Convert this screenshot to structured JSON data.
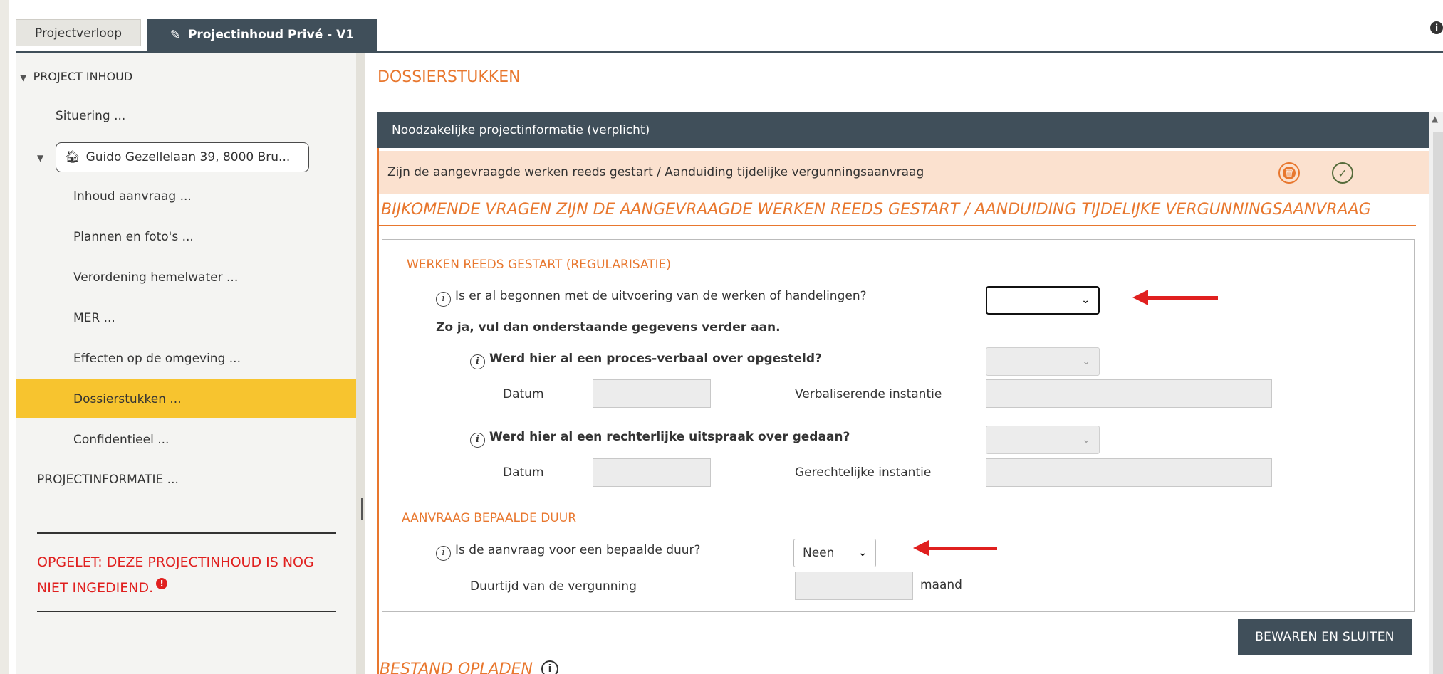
{
  "tabs": {
    "inactive_label": "Projectverloop",
    "active_label": "Projectinhoud Privé - V1"
  },
  "sidebar": {
    "root_label": "PROJECT INHOUD",
    "situering": "Situering ...",
    "address": "Guido Gezellelaan 39, 8000 Bru...",
    "items": [
      "Inhoud aanvraag ...",
      "Plannen en foto's ...",
      "Verordening hemelwater ...",
      "MER ...",
      "Effecten op de omgeving ...",
      "Dossierstukken ...",
      "Confidentieel ..."
    ],
    "active_item_index": 5,
    "projectinformatie": "PROJECTINFORMATIE ...",
    "warning": "OPGELET: DEZE PROJECTINHOUD IS NOG NIET INGEDIEND."
  },
  "main": {
    "page_title": "DOSSIERSTUKKEN",
    "panel_header": "Noodzakelijke projectinformatie (verplicht)",
    "selected_row": "Zijn de aangevraagde werken reeds gestart / Aanduiding tijdelijke vergunningsaanvraag",
    "section_heading": "BIJKOMENDE VRAGEN ZIJN DE AANGEVRAAGDE WERKEN REEDS GESTART / AANDUIDING TIJDELIJKE VERGUNNINGSAANVRAAG",
    "form": {
      "section1_title": "WERKEN REEDS GESTART (REGULARISATIE)",
      "q_started": "Is er al begonnen met de uitvoering van de werken of handelingen?",
      "q_started_value": "",
      "q_started_hint": "Zo ja, vul dan onderstaande gegevens verder aan.",
      "q_pv": "Werd hier al een proces-verbaal over opgesteld?",
      "date_label_1": "Datum",
      "verbalising_label": "Verbaliserende instantie",
      "q_court": "Werd hier al een rechterlijke uitspraak over gedaan?",
      "date_label_2": "Datum",
      "court_label": "Gerechtelijke instantie",
      "section2_title": "AANVRAAG BEPAALDE DUUR",
      "q_duration": "Is de aanvraag voor een bepaalde duur?",
      "q_duration_value": "Neen",
      "duration_label": "Duurtijd van de vergunning",
      "duration_unit": "maand"
    },
    "save_button": "BEWAREN EN SLUITEN",
    "upload_heading": "BESTAND OPLADEN"
  },
  "colors": {
    "accent_orange": "#e8772e",
    "header_slate": "#404f5a",
    "active_yellow": "#f7c42f",
    "warning_red": "#e0201f",
    "row_salmon": "#fbe1cf"
  }
}
